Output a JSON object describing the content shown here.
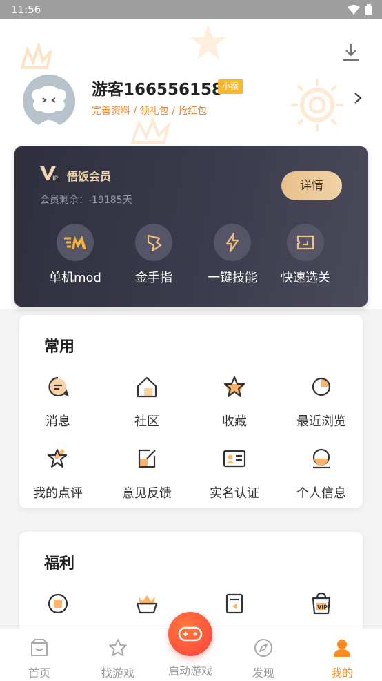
{
  "status_bar": {
    "time": "11:56"
  },
  "profile": {
    "username": "游客166556158",
    "level_badge": "小猴",
    "subtitle": "完善资料 / 领礼包 / 抢红包"
  },
  "vip": {
    "title": "悟饭会员",
    "remaining": "会员剩余：-19185天",
    "detail_button": "详情",
    "features": [
      {
        "label": "单机mod",
        "icon": "mod-icon"
      },
      {
        "label": "金手指",
        "icon": "golden-finger-icon"
      },
      {
        "label": "一键技能",
        "icon": "lightning-icon"
      },
      {
        "label": "快速选关",
        "icon": "level-select-icon"
      }
    ]
  },
  "common": {
    "title": "常用",
    "items": [
      {
        "label": "消息",
        "icon": "message-icon"
      },
      {
        "label": "社区",
        "icon": "community-icon"
      },
      {
        "label": "收藏",
        "icon": "favorite-icon"
      },
      {
        "label": "最近浏览",
        "icon": "recent-icon"
      },
      {
        "label": "我的点评",
        "icon": "review-icon"
      },
      {
        "label": "意见反馈",
        "icon": "feedback-icon"
      },
      {
        "label": "实名认证",
        "icon": "id-card-icon"
      },
      {
        "label": "个人信息",
        "icon": "personal-info-icon"
      }
    ]
  },
  "welfare": {
    "title": "福利",
    "items": [
      {
        "icon": "coin-icon"
      },
      {
        "icon": "crown-box-icon"
      },
      {
        "icon": "ticket-icon"
      },
      {
        "icon": "vip-bag-icon"
      }
    ]
  },
  "bottom_nav": {
    "items": [
      {
        "label": "首页",
        "icon": "home-icon"
      },
      {
        "label": "找游戏",
        "icon": "star-icon"
      },
      {
        "label": "启动游戏",
        "icon": "gamepad-icon"
      },
      {
        "label": "发现",
        "icon": "compass-icon"
      },
      {
        "label": "我的",
        "icon": "user-icon"
      }
    ],
    "active": "我的"
  },
  "colors": {
    "accent": "#ff8a1e",
    "vip_gold": "#f1d7ad",
    "card_dark": "#33343f",
    "badge": "#f7b72d"
  }
}
